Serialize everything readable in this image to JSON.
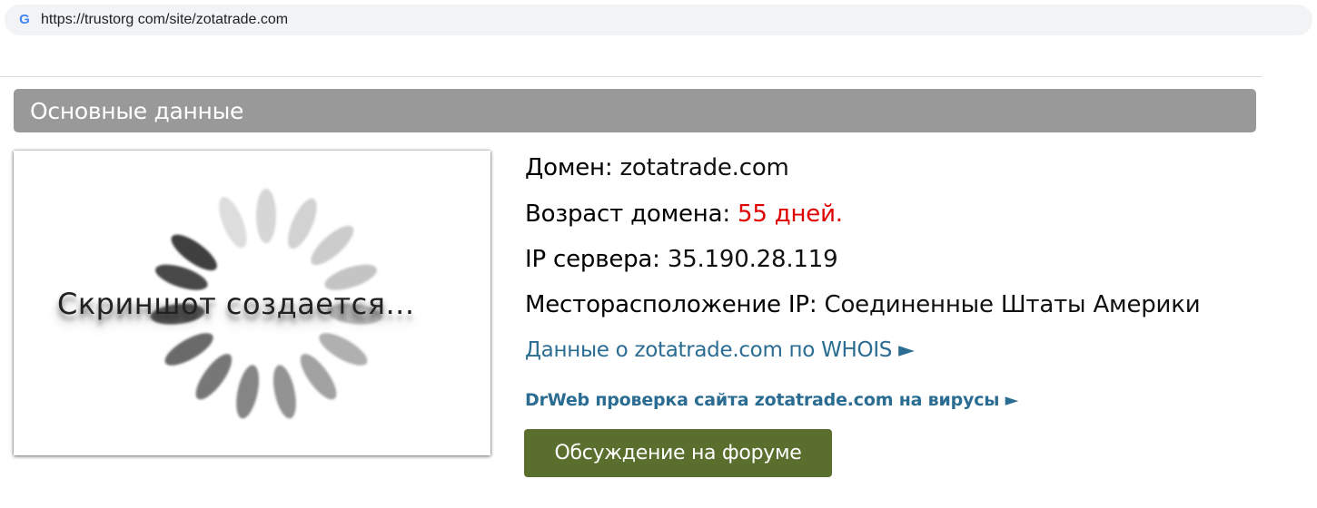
{
  "browser": {
    "url": "https://trustorg com/site/zotatrade.com",
    "site_icon": "google-g-icon"
  },
  "section": {
    "title": "Основные данные"
  },
  "screenshot": {
    "caption": "Скриншот создается...",
    "icon": "loading-spinner-icon"
  },
  "info": {
    "domain_key": "Домен:",
    "domain_value": "zotatrade.com",
    "age_key": "Возраст домена:",
    "age_value": "55 дней.",
    "ip_key": "IP сервера:",
    "ip_value": "35.190.28.119",
    "location_key": "Месторасположение IP:",
    "location_value": "Соединенные Штаты Америки"
  },
  "links": {
    "whois": "Данные о zotatrade.com по WHOIS ►",
    "drweb": "DrWeb проверка сайта zotatrade.com на вирусы ►"
  },
  "forum_button": "Обсуждение на форуме",
  "colors": {
    "header_bg": "#999999",
    "link": "#2b6c92",
    "age_value": "#e00000",
    "button_bg": "#5a6e2e"
  }
}
